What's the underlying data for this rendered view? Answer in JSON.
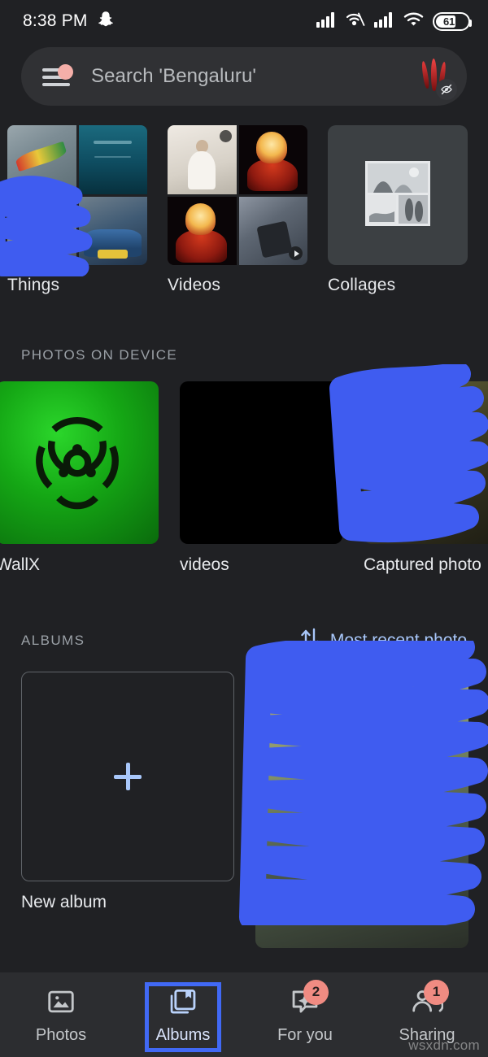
{
  "status_bar": {
    "time": "8:38 PM",
    "app_icon": "snapchat-icon",
    "icons": [
      "signal-bars-icon",
      "wifi-calling-icon",
      "signal-bars-icon",
      "wifi-icon"
    ],
    "battery_percent": "61"
  },
  "search": {
    "placeholder": "Search 'Bengaluru'",
    "menu_icon": "hamburger-menu-icon",
    "notification_dot": true,
    "avatar_badge_icon": "backup-paused-eye-off-icon"
  },
  "top_albums": [
    {
      "label": "Things",
      "kind": "photo-grid",
      "redacted": true
    },
    {
      "label": "Videos",
      "kind": "photo-grid",
      "redacted": false
    },
    {
      "label": "Collages",
      "kind": "placeholder",
      "redacted": false
    }
  ],
  "device_section": {
    "title": "PHOTOS ON DEVICE",
    "items": [
      {
        "label": "WallX",
        "kind": "green-biohazard",
        "redacted": false
      },
      {
        "label": "videos",
        "kind": "black",
        "redacted": false
      },
      {
        "label": "Captured photo",
        "kind": "photo",
        "redacted": true
      }
    ]
  },
  "albums_section": {
    "title": "ALBUMS",
    "sort": {
      "icon": "sort-arrows-icon",
      "label": "Most recent photo"
    },
    "new_album": {
      "label": "New album",
      "icon": "plus-icon"
    },
    "items": [
      {
        "label": "",
        "kind": "photo",
        "redacted": true
      }
    ]
  },
  "bottom_nav": {
    "items": [
      {
        "label": "Photos",
        "icon": "photos-image-icon",
        "badge": "",
        "active": false
      },
      {
        "label": "Albums",
        "icon": "albums-book-icon",
        "badge": "",
        "active": true
      },
      {
        "label": "For you",
        "icon": "for-you-spark-icon",
        "badge": "2",
        "active": false
      },
      {
        "label": "Sharing",
        "icon": "sharing-people-icon",
        "badge": "1",
        "active": false
      }
    ]
  },
  "watermark": "wsxdn.com",
  "colors": {
    "background": "#202124",
    "surface": "#303134",
    "card_grey": "#3c4043",
    "accent_blue": "#a8c7fa",
    "active_outline": "#4169f5",
    "badge_salmon": "#f08b82",
    "redaction_blue": "#3f5cf0",
    "text_primary": "#e8eaed",
    "text_secondary": "#9aa0a6",
    "nav_bar": "#2c2d30"
  }
}
